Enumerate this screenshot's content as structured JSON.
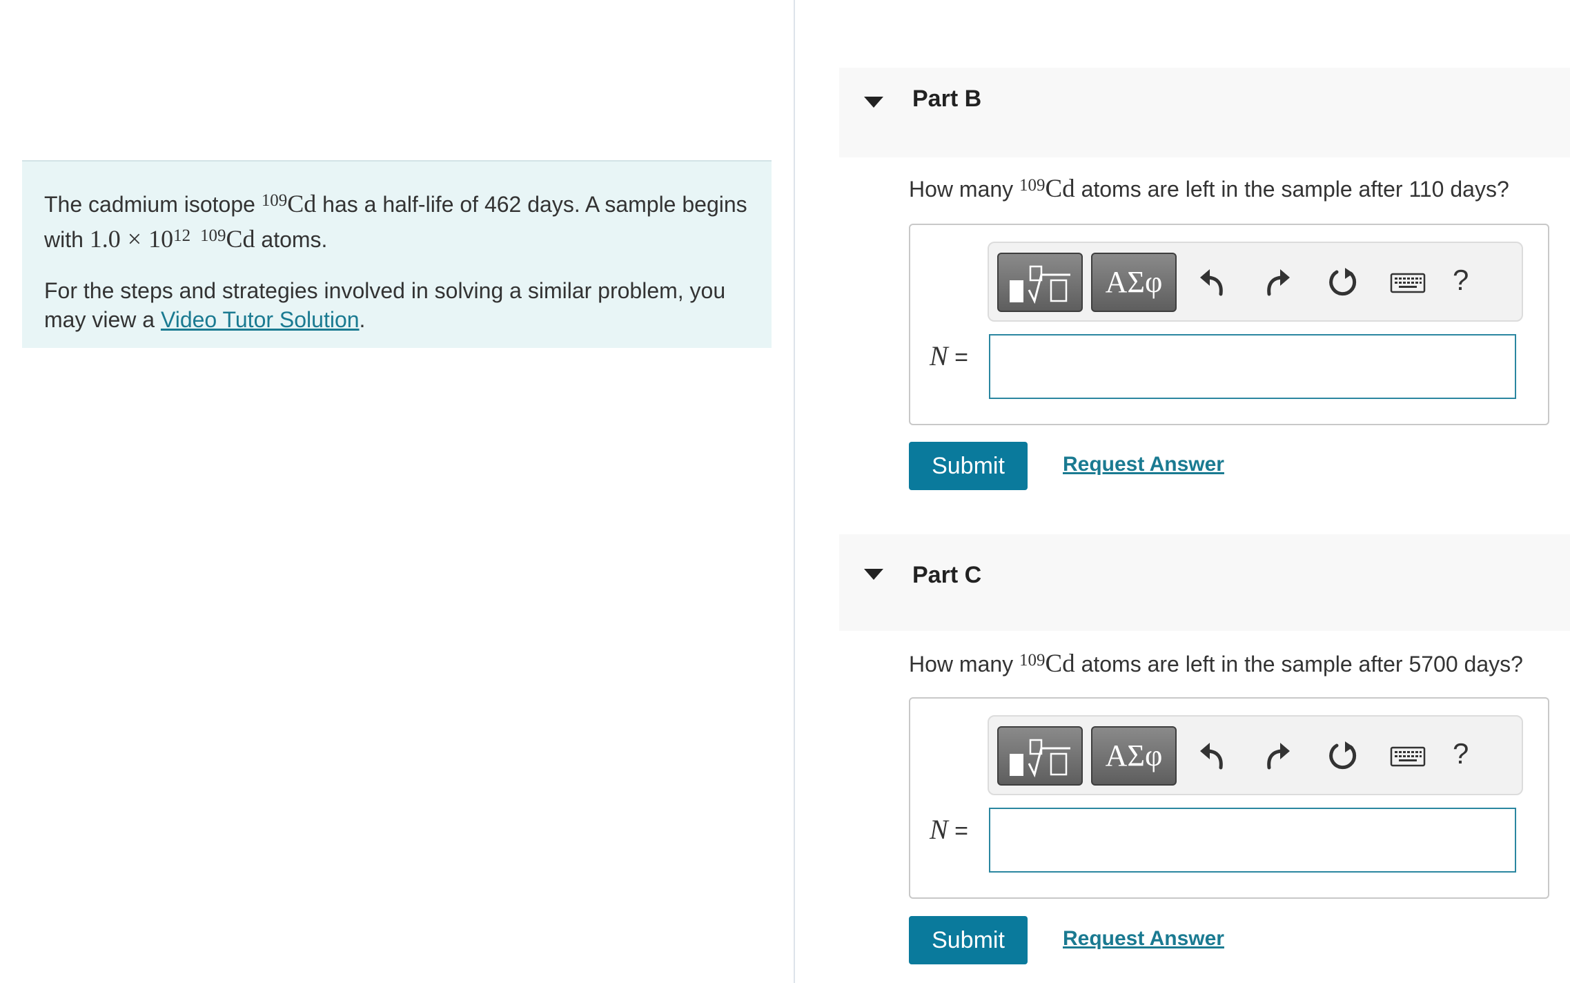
{
  "intro": {
    "p1_a": "The cadmium isotope ",
    "iso_mass": "109",
    "element": "Cd",
    "p1_b": " has a half-life of 462 days. A sample begins with ",
    "amount_mantissa": "1.0",
    "times": "×",
    "amount_base": "10",
    "amount_exp": "12",
    "p1_c": " atoms.",
    "p2_a": "For the steps and strategies involved in solving a similar problem, you may view a ",
    "link_text": "Video Tutor Solution",
    "p2_b": "."
  },
  "parts": [
    {
      "title": "Part B",
      "q_pre": "How many ",
      "q_mass": "109",
      "q_el": "Cd",
      "q_post": " atoms are left in the sample after 110 days?",
      "var": "N",
      "eq": " =",
      "value": "",
      "submit": "Submit",
      "request": "Request Answer"
    },
    {
      "title": "Part C",
      "q_pre": "How many ",
      "q_mass": "109",
      "q_el": "Cd",
      "q_post": " atoms are left in the sample after 5700 days?",
      "var": "N",
      "eq": " =",
      "value": "",
      "submit": "Submit",
      "request": "Request Answer"
    }
  ],
  "toolbar": {
    "greek_label": "ΑΣφ",
    "help_label": "?",
    "icons": [
      "templates-icon",
      "undo-icon",
      "redo-icon",
      "reset-icon",
      "keyboard-icon",
      "help-icon"
    ]
  },
  "colors": {
    "intro_bg": "#e8f5f6",
    "accent": "#0a7a9c",
    "link": "#1a7a91"
  }
}
